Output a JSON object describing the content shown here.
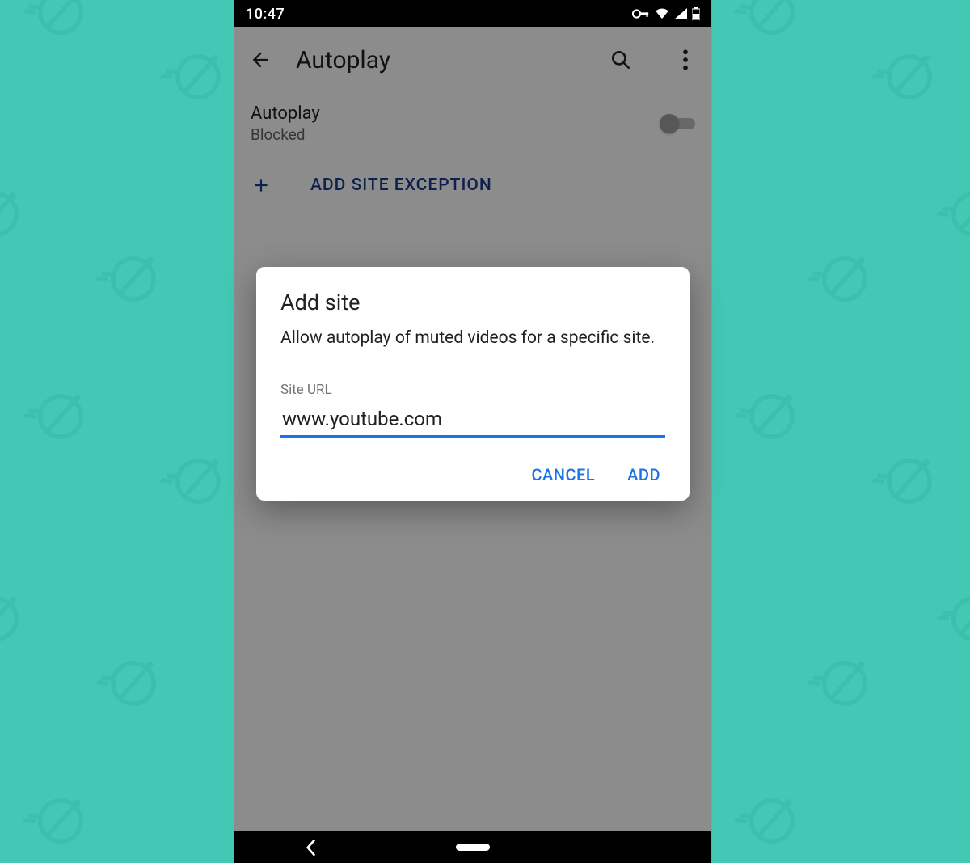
{
  "statusbar": {
    "time": "10:47"
  },
  "appbar": {
    "title": "Autoplay"
  },
  "setting": {
    "label": "Autoplay",
    "status": "Blocked",
    "toggle_on": false
  },
  "add_exception": {
    "label": "ADD SITE EXCEPTION"
  },
  "dialog": {
    "title": "Add site",
    "description": "Allow autoplay of muted videos for a specific site.",
    "field_label": "Site URL",
    "field_value": "www.youtube.com",
    "cancel_label": "CANCEL",
    "confirm_label": "ADD"
  },
  "colors": {
    "accent": "#1a73e8",
    "background": "#43c8b6",
    "exception_link": "#1a3c8c"
  }
}
